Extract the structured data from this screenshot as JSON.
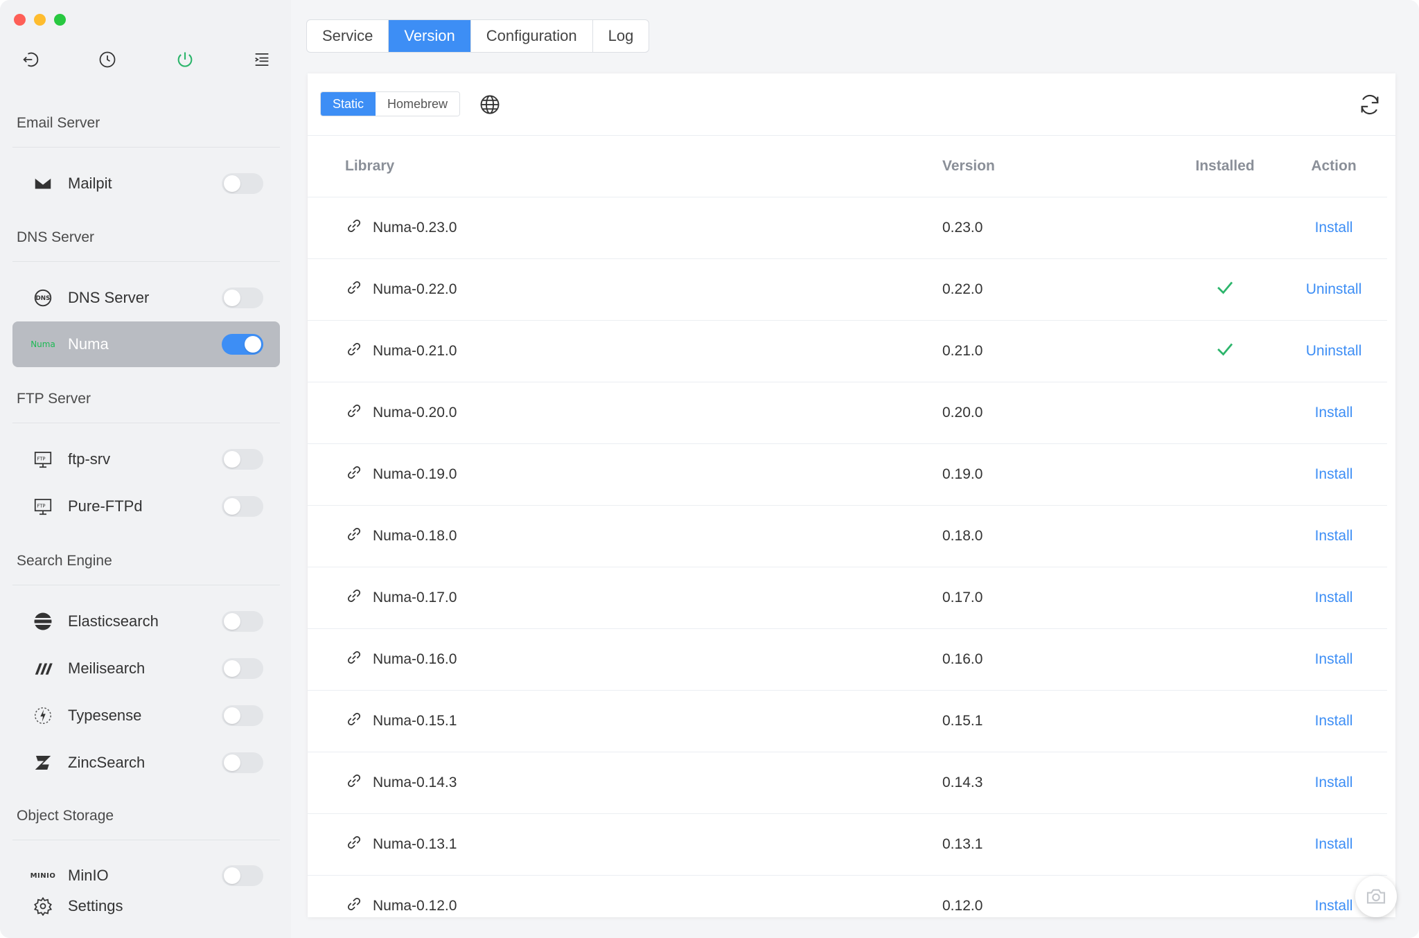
{
  "sidebar": {
    "groups": {
      "email": "Email Server",
      "dns": "DNS Server",
      "ftp": "FTP Server",
      "search": "Search Engine",
      "storage": "Object Storage"
    },
    "items": {
      "mailpit": "Mailpit",
      "dns_server": "DNS Server",
      "numa_logo": "Numa",
      "numa": "Numa",
      "ftp_srv": "ftp-srv",
      "pure_ftpd": "Pure-FTPd",
      "elasticsearch": "Elasticsearch",
      "meilisearch": "Meilisearch",
      "typesense": "Typesense",
      "zincsearch": "ZincSearch",
      "minio": "MinIO",
      "minio_logo": "MINIO"
    },
    "settings": "Settings"
  },
  "tabs": [
    "Service",
    "Version",
    "Configuration",
    "Log"
  ],
  "panel": {
    "seg_static": "Static",
    "seg_homebrew": "Homebrew"
  },
  "table": {
    "headers": {
      "library": "Library",
      "version": "Version",
      "installed": "Installed",
      "action": "Action"
    },
    "rows": [
      {
        "library": "Numa-0.23.0",
        "version": "0.23.0",
        "installed": false,
        "action": "Install"
      },
      {
        "library": "Numa-0.22.0",
        "version": "0.22.0",
        "installed": true,
        "action": "Uninstall"
      },
      {
        "library": "Numa-0.21.0",
        "version": "0.21.0",
        "installed": true,
        "action": "Uninstall"
      },
      {
        "library": "Numa-0.20.0",
        "version": "0.20.0",
        "installed": false,
        "action": "Install"
      },
      {
        "library": "Numa-0.19.0",
        "version": "0.19.0",
        "installed": false,
        "action": "Install"
      },
      {
        "library": "Numa-0.18.0",
        "version": "0.18.0",
        "installed": false,
        "action": "Install"
      },
      {
        "library": "Numa-0.17.0",
        "version": "0.17.0",
        "installed": false,
        "action": "Install"
      },
      {
        "library": "Numa-0.16.0",
        "version": "0.16.0",
        "installed": false,
        "action": "Install"
      },
      {
        "library": "Numa-0.15.1",
        "version": "0.15.1",
        "installed": false,
        "action": "Install"
      },
      {
        "library": "Numa-0.14.3",
        "version": "0.14.3",
        "installed": false,
        "action": "Install"
      },
      {
        "library": "Numa-0.13.1",
        "version": "0.13.1",
        "installed": false,
        "action": "Install"
      },
      {
        "library": "Numa-0.12.0",
        "version": "0.12.0",
        "installed": false,
        "action": "Install"
      }
    ]
  },
  "colors": {
    "accent": "#3d8ef5",
    "check": "#2cb56b",
    "numa_logo": "#1db954"
  }
}
